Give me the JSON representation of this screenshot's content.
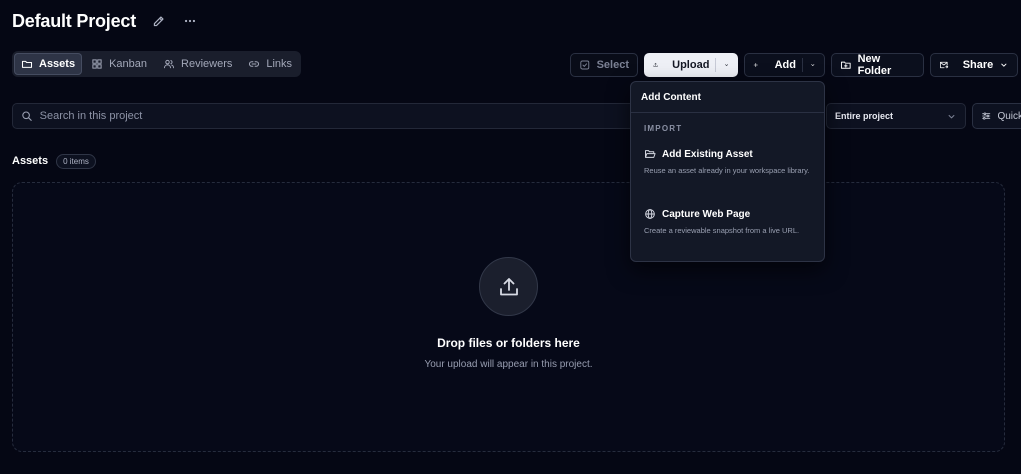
{
  "project": {
    "title": "Default Project"
  },
  "tabs": [
    {
      "label": "Assets",
      "icon": "folder-icon",
      "active": true
    },
    {
      "label": "Kanban",
      "icon": "grid-icon",
      "active": false
    },
    {
      "label": "Reviewers",
      "icon": "users-icon",
      "active": false
    },
    {
      "label": "Links",
      "icon": "link-icon",
      "active": false
    }
  ],
  "toolbar": {
    "select_label": "Select",
    "upload_label": "Upload",
    "add_label": "Add",
    "new_folder_label": "New Folder",
    "share_label": "Share"
  },
  "search": {
    "placeholder": "Search in this project",
    "value": ""
  },
  "scope": {
    "selected": "Entire project"
  },
  "quick": {
    "label": "Quick"
  },
  "assets": {
    "label": "Assets",
    "count": "0 items"
  },
  "dropzone": {
    "title": "Drop files or folders here",
    "subtitle": "Your upload will appear in this project."
  },
  "add_menu": {
    "title": "Add Content",
    "section": "IMPORT",
    "items": [
      {
        "label": "Add Existing Asset",
        "description": "Reuse an asset already in your workspace library.",
        "icon": "folder-open-icon"
      },
      {
        "label": "Capture Web Page",
        "description": "Create a reviewable snapshot from a live URL.",
        "icon": "globe-icon"
      }
    ]
  },
  "colors": {
    "background": "#050714",
    "upload_button": "#eef0f6",
    "menu_background": "#131826"
  }
}
